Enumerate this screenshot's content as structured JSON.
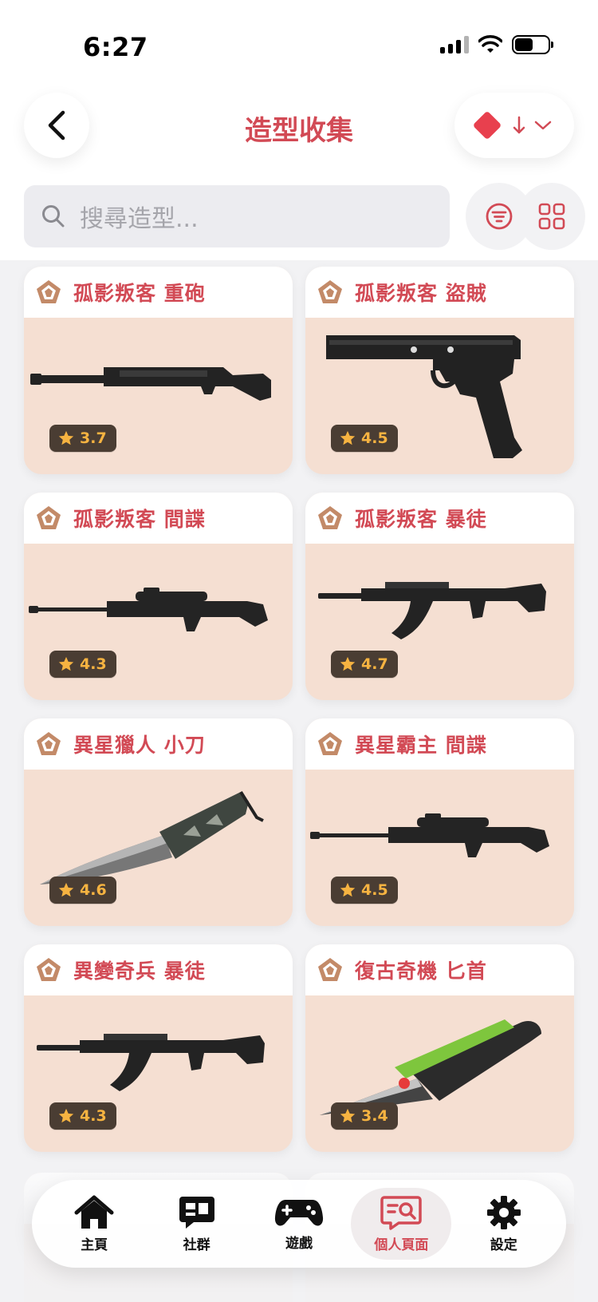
{
  "status": {
    "time": "6:27"
  },
  "header": {
    "title": "造型收集"
  },
  "search": {
    "placeholder": "搜尋造型..."
  },
  "colors": {
    "accent": "#d24a55",
    "card_bg": "#f5dfd2",
    "rating_text": "#f6b341"
  },
  "cards": [
    {
      "name": "孤影叛客 重砲",
      "rating": "3.7",
      "weapon": "heavy-rifle"
    },
    {
      "name": "孤影叛客 盜賊",
      "rating": "4.5",
      "weapon": "pistol"
    },
    {
      "name": "孤影叛客 間諜",
      "rating": "4.3",
      "weapon": "sniper"
    },
    {
      "name": "孤影叛客 暴徒",
      "rating": "4.7",
      "weapon": "assault-rifle"
    },
    {
      "name": "異星獵人 小刀",
      "rating": "4.6",
      "weapon": "knife"
    },
    {
      "name": "異星霸主 間諜",
      "rating": "4.5",
      "weapon": "sniper"
    },
    {
      "name": "異變奇兵 暴徒",
      "rating": "4.3",
      "weapon": "assault-rifle"
    },
    {
      "name": "復古奇機 匕首",
      "rating": "3.4",
      "weapon": "dagger"
    }
  ],
  "tabbar": {
    "items": [
      {
        "label": "主頁",
        "icon": "home-icon"
      },
      {
        "label": "社群",
        "icon": "chat-icon"
      },
      {
        "label": "遊戲",
        "icon": "gamepad-icon"
      },
      {
        "label": "個人頁面",
        "icon": "profile-search-icon",
        "active": true
      },
      {
        "label": "設定",
        "icon": "gear-icon"
      }
    ]
  }
}
